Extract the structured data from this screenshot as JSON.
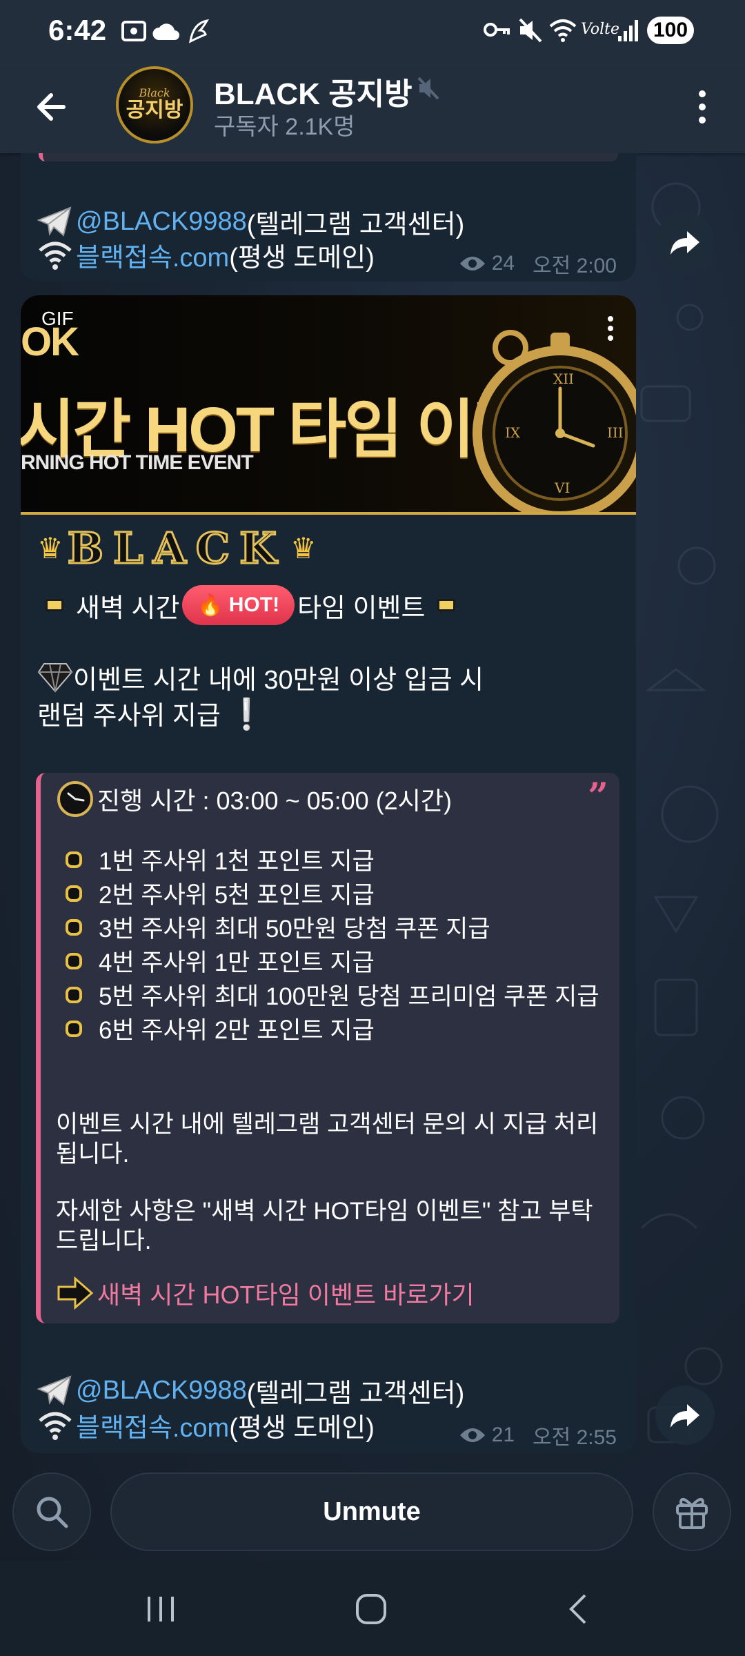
{
  "status_bar": {
    "time": "6:42",
    "battery": "100",
    "network": "Volte"
  },
  "header": {
    "title": "BLACK 공지방",
    "subscribers": "구독자 2.1K명",
    "avatar_small": "Black",
    "avatar_big": "공지방"
  },
  "messages": [
    {
      "contact_handle": "@BLACK9988",
      "contact_desc": " (텔레그램 고객센터)",
      "domain_link": "블랙접속.com",
      "domain_desc": " (평생 도메인)",
      "views": "24",
      "time": "오전 2:00"
    },
    {
      "gif_label": "GIF",
      "gif_ok": "OK",
      "gif_headline": "시간 HOT 타임 이벤트",
      "gif_sub": "RNING HOT TIME EVENT",
      "brand": "BLACK",
      "event_title_left": "새벽 시간",
      "hot_badge": "HOT!",
      "event_title_right": "타임 이벤트",
      "intro_line1": "이벤트 시간 내에 30만원 이상 입금 시",
      "intro_line2": "랜덤 주사위 지급",
      "quote": {
        "progress": "진행 시간 : 03:00 ~ 05:00 (2시간)",
        "dice": [
          "1번 주사위 1천 포인트 지급",
          "2번 주사위 5천 포인트 지급",
          "3번 주사위 최대 50만원 당첨 쿠폰 지급",
          "4번 주사위 1만 포인트 지급",
          "5번 주사위 최대 100만원 당첨 프리미엄 쿠폰 지급",
          "6번 주사위 2만 포인트 지급"
        ],
        "note1": "이벤트 시간 내에 텔레그램 고객센터 문의 시 지급 처리됩니다.",
        "note2": "자세한 사항은 \"새벽 시간 HOT타임 이벤트\" 참고 부탁드립니다.",
        "link": "새벽 시간 HOT타임 이벤트 바로가기"
      },
      "contact_handle": "@BLACK9988",
      "contact_desc": " (텔레그램 고객센터)",
      "domain_link": "블랙접속.com",
      "domain_desc": " (평생 도메인)",
      "views": "21",
      "time": "오전 2:55"
    }
  ],
  "bottom_bar": {
    "unmute_label": "Unmute"
  },
  "icons": {
    "back": "arrow-left-icon",
    "menu": "three-dots-vertical-icon",
    "mute": "muted-speaker-icon",
    "share": "share-arrow-icon",
    "search": "search-icon",
    "gift": "gift-icon",
    "views": "eye-icon"
  },
  "colors": {
    "header_bg": "#232e3c",
    "bubble_bg": "#182533",
    "link": "#62b1f0",
    "quote_accent": "#e3638e",
    "hot_badge": "#e0344d"
  }
}
